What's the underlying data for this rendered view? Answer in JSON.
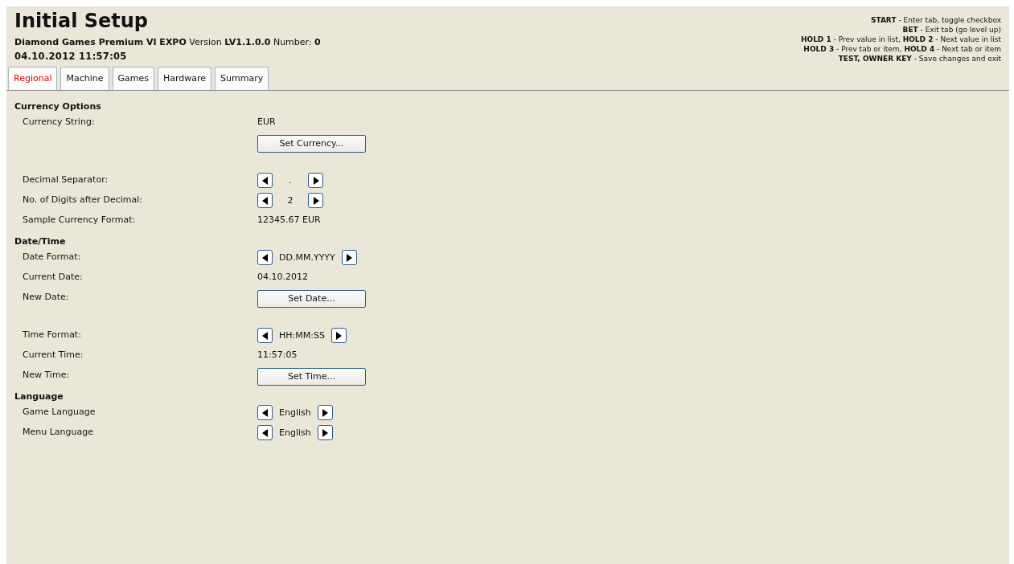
{
  "title": "Initial Setup",
  "subtitle": "**Diamond Games Premium VI EXPO** Version **LV1.1.0.0** Number: **0**",
  "datetime": "04.10.2012 11:57:05",
  "help": [
    "**START** - Enter tab, toggle checkbox",
    "**BET** - Exit tab (go level up)",
    "**HOLD 1** - Prev value in list, **HOLD 2** - Next value in list",
    "**HOLD 3** - Prev tab or item, **HOLD 4** - Next tab or item",
    "**TEST, OWNER KEY** - Save changes and exit"
  ],
  "tabs": [
    {
      "label": "Regional",
      "selected": true
    },
    {
      "label": "Machine",
      "selected": false
    },
    {
      "label": "Games",
      "selected": false
    },
    {
      "label": "Hardware",
      "selected": false
    },
    {
      "label": "Summary",
      "selected": false
    }
  ],
  "sections": [
    {
      "heading": "Currency Options",
      "rows": [
        {
          "kind": "value",
          "label": "Currency String:",
          "value": "EUR"
        },
        {
          "kind": "button",
          "label": "",
          "value": "Set Currency..."
        },
        {
          "kind": "spinner",
          "label": "Decimal Separator:",
          "value": "."
        },
        {
          "kind": "spinner",
          "label": "No. of Digits after Decimal:",
          "value": "2"
        },
        {
          "kind": "value",
          "label": "Sample Currency Format:",
          "value": "12345.67 EUR"
        }
      ]
    },
    {
      "heading": "Date/Time",
      "rows": [
        {
          "kind": "spinner",
          "label": "Date Format:",
          "value": "DD.MM.YYYY"
        },
        {
          "kind": "value",
          "label": "Current Date:",
          "value": "04.10.2012"
        },
        {
          "kind": "button",
          "label": "New Date:",
          "value": "Set Date..."
        },
        {
          "kind": "spinner",
          "label": "Time Format:",
          "value": "HH:MM:SS"
        },
        {
          "kind": "value",
          "label": "Current Time:",
          "value": "11:57:05"
        },
        {
          "kind": "button",
          "label": "New Time:",
          "value": "Set Time..."
        }
      ]
    },
    {
      "heading": "Language",
      "rows": [
        {
          "kind": "spinner",
          "label": "Game Language",
          "value": "English"
        },
        {
          "kind": "spinner",
          "label": "Menu Language",
          "value": "English"
        }
      ]
    }
  ]
}
